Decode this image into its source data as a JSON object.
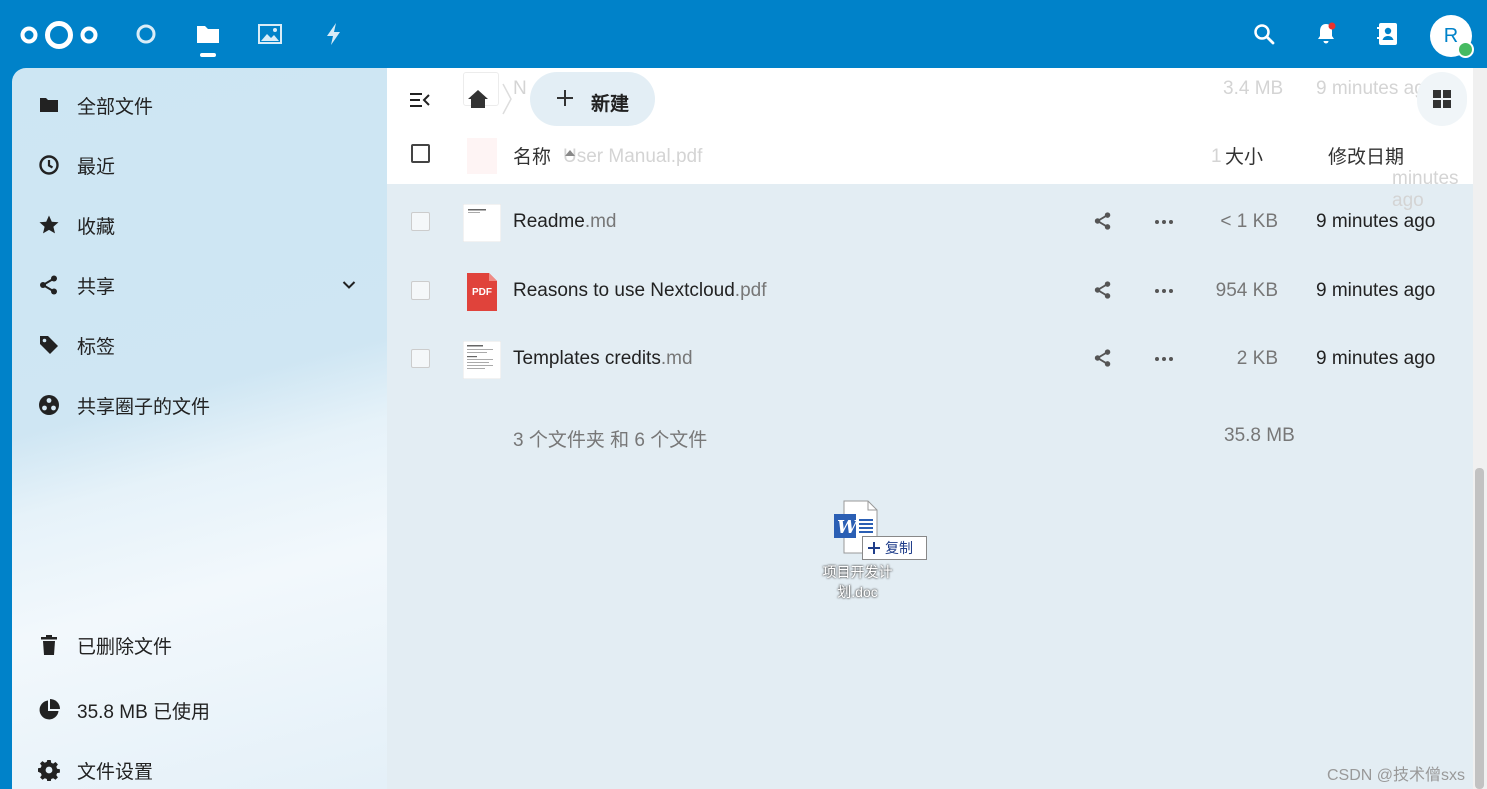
{
  "header": {
    "apps": [
      {
        "name": "dashboard",
        "icon": "dashboard-icon"
      },
      {
        "name": "files",
        "icon": "folder-icon",
        "active": true
      },
      {
        "name": "photos",
        "icon": "image-icon"
      },
      {
        "name": "activity",
        "icon": "lightning-icon"
      }
    ],
    "right": [
      "search-icon",
      "notifications-icon",
      "contacts-icon"
    ],
    "avatar_initial": "R"
  },
  "sidebar": {
    "items": [
      {
        "label": "全部文件",
        "icon": "folder-icon"
      },
      {
        "label": "最近",
        "icon": "clock-icon"
      },
      {
        "label": "收藏",
        "icon": "star-icon"
      },
      {
        "label": "共享",
        "icon": "share-icon",
        "expandable": true
      },
      {
        "label": "标签",
        "icon": "tag-icon"
      },
      {
        "label": "共享圈子的文件",
        "icon": "circles-icon"
      }
    ],
    "bottom": [
      {
        "label": "已删除文件",
        "icon": "trash-icon"
      },
      {
        "label": "35.8 MB 已使用",
        "icon": "pie-chart-icon"
      },
      {
        "label": "文件设置",
        "icon": "gear-icon"
      }
    ]
  },
  "toolbar": {
    "new_label": "新建"
  },
  "columns": {
    "name": "名称",
    "size": "大小",
    "modified": "修改日期"
  },
  "ghost_rows": [
    {
      "name_frag": "N",
      "size": "3.4 MB",
      "mod": "9 minutes ago"
    },
    {
      "name_frag": "User Manual.pdf",
      "size": "1",
      "mod": "9 minutes ago"
    }
  ],
  "files": [
    {
      "base": "Readme",
      "ext": ".md",
      "size": "< 1 KB",
      "modified": "9 minutes ago",
      "type": "text"
    },
    {
      "base": "Reasons to use Nextcloud",
      "ext": ".pdf",
      "size": "954 KB",
      "modified": "9 minutes ago",
      "type": "pdf",
      "badge": "PDF"
    },
    {
      "base": "Templates credits",
      "ext": ".md",
      "size": "2 KB",
      "modified": "9 minutes ago",
      "type": "text"
    }
  ],
  "summary": {
    "text": "3 个文件夹 和 6 个文件",
    "size": "35.8 MB"
  },
  "drag": {
    "copy_label": "复制",
    "filename_line1": "项目开发计",
    "filename_line2": "划.doc"
  },
  "watermark": "CSDN @技术僧sxs",
  "colors": {
    "brand": "#0082c9",
    "pdf": "#e0433b",
    "status_online": "#46ba61"
  }
}
